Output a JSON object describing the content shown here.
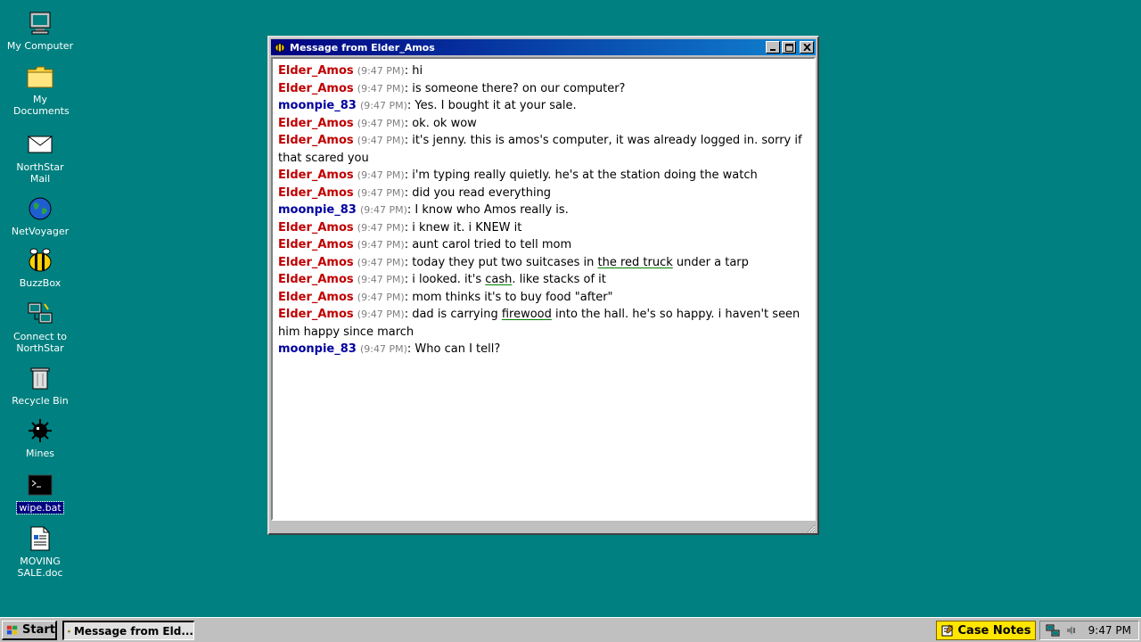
{
  "desktop": {
    "icons": [
      {
        "label": "My Computer"
      },
      {
        "label": "My Documents"
      },
      {
        "label": "NorthStar Mail"
      },
      {
        "label": "NetVoyager"
      },
      {
        "label": "BuzzBox"
      },
      {
        "label": "Connect to NorthStar"
      },
      {
        "label": "Recycle Bin"
      },
      {
        "label": "Mines"
      },
      {
        "label": "wipe.bat"
      },
      {
        "label": "MOVING SALE.doc"
      }
    ]
  },
  "window": {
    "title": "Message from Elder_Amos",
    "minimize": "_",
    "maximize": "□",
    "close": "✕"
  },
  "chat": {
    "messages": [
      {
        "user": "Elder_Amos",
        "time": "(9:47 PM)",
        "text": "hi"
      },
      {
        "user": "Elder_Amos",
        "time": "(9:47 PM)",
        "text": "is someone there? on our computer?"
      },
      {
        "user": "moonpie_83",
        "time": "(9:47 PM)",
        "text": "Yes. I bought it at your sale."
      },
      {
        "user": "Elder_Amos",
        "time": "(9:47 PM)",
        "text": "ok. ok wow"
      },
      {
        "user": "Elder_Amos",
        "time": "(9:47 PM)",
        "text": "it's jenny. this is amos's computer, it was already logged in. sorry if that scared you"
      },
      {
        "user": "Elder_Amos",
        "time": "(9:47 PM)",
        "text": "i'm typing really quietly. he's at the station doing the watch"
      },
      {
        "user": "Elder_Amos",
        "time": "(9:47 PM)",
        "text": "did you read everything"
      },
      {
        "user": "moonpie_83",
        "time": "(9:47 PM)",
        "text": "I know who Amos really is."
      },
      {
        "user": "Elder_Amos",
        "time": "(9:47 PM)",
        "text": "i knew it. i KNEW it"
      },
      {
        "user": "Elder_Amos",
        "time": "(9:47 PM)",
        "text": "aunt carol tried to tell mom"
      },
      {
        "user": "Elder_Amos",
        "time": "(9:47 PM)",
        "text_pre": "today they put two suitcases in ",
        "link": "the red truck",
        "text_post": " under a tarp"
      },
      {
        "user": "Elder_Amos",
        "time": "(9:47 PM)",
        "text_pre": "i looked. it's ",
        "link": "cash",
        "text_post": ". like stacks of it"
      },
      {
        "user": "Elder_Amos",
        "time": "(9:47 PM)",
        "text": "mom thinks it's to buy food \"after\""
      },
      {
        "user": "Elder_Amos",
        "time": "(9:47 PM)",
        "text_pre": "dad is carrying ",
        "link": "firewood",
        "text_post": " into the hall. he's so happy. i haven't seen him happy since march"
      },
      {
        "user": "moonpie_83",
        "time": "(9:47 PM)",
        "text": "Who can I tell?"
      }
    ]
  },
  "taskbar": {
    "start_label": "Start",
    "task_label": "Message from Eld...",
    "case_notes_label": "Case Notes",
    "clock": "9:47 PM"
  },
  "colors": {
    "desktop": "#008080",
    "elder": "#c00000",
    "moonpie": "#0000a0",
    "case_notes": "#ffe600"
  }
}
